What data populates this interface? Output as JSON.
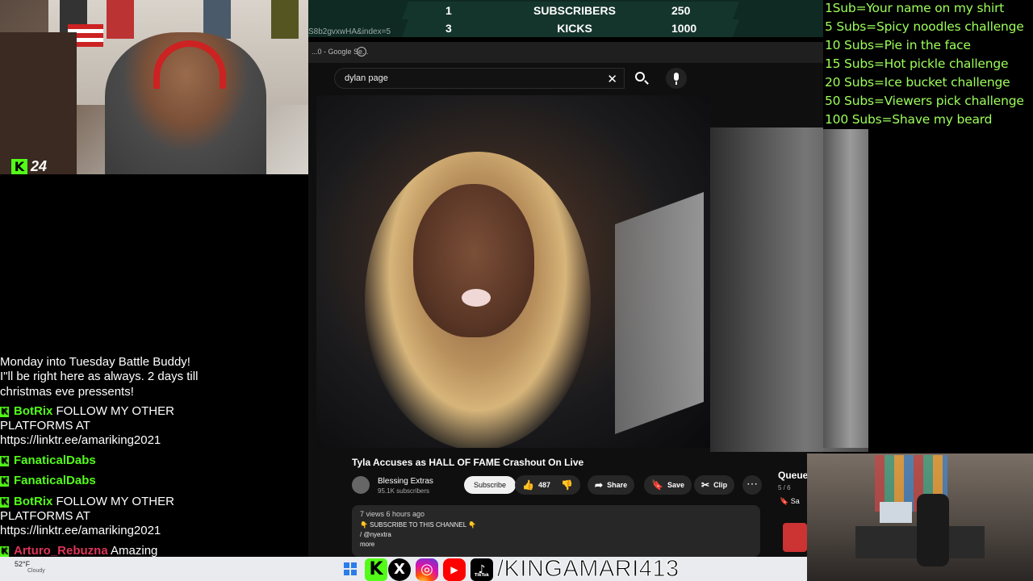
{
  "webcam": {
    "kick_count": "24"
  },
  "counters": {
    "rows": [
      {
        "current": "1",
        "label": "SUBSCRIBERS",
        "goal": "250"
      },
      {
        "current": "3",
        "label": "KICKS",
        "goal": "1000"
      }
    ],
    "url_fragment": "S8b2gvxwHA&index=5"
  },
  "browser": {
    "tab_text": "...0 - Google Se..."
  },
  "youtube": {
    "search_query": "dylan page",
    "video_title": "Tyla Accuses as HALL OF FAME Crashout On Live",
    "channel_name": "Blessing Extras",
    "channel_subs": "95.1K subscribers",
    "subscribe_label": "Subscribe",
    "likes": "487",
    "share_label": "Share",
    "save_label": "Save",
    "clip_label": "Clip",
    "more_label": "⋯",
    "desc_stats": "7 views  6 hours ago",
    "desc_line1": "👇 SUBSCRIBE TO THIS CHANNEL 👇",
    "desc_line2": "/ @nyextra",
    "desc_line3": "more",
    "queue_title": "Queue",
    "queue_count": "5 / 6",
    "queue_save": "Sa"
  },
  "goals": [
    "1Sub=Your name on my shirt",
    "5 Subs=Spicy noodles challenge",
    "10 Subs=Pie in the face",
    "15 Subs=Hot pickle challenge",
    "20 Subs=Ice bucket challenge",
    "50 Subs=Viewers pick challenge",
    "100 Subs=Shave my beard"
  ],
  "chat": [
    {
      "text": "Monday into Tuesday Battle Buddy!"
    },
    {
      "text": "I\"ll be right here as always. 2 days till"
    },
    {
      "text": "christmas eve pressents!"
    },
    {
      "user": "BotRix",
      "color": "#53fc18",
      "text": "FOLLOW MY OTHER"
    },
    {
      "text": "PLATFORMS AT"
    },
    {
      "text": "https://linktr.ee/amariking2021"
    },
    {
      "user": "FanaticalDabs",
      "color": "#53fc18",
      "text": ""
    },
    {
      "user": "FanaticalDabs",
      "color": "#53fc18",
      "text": ""
    },
    {
      "user": "BotRix",
      "color": "#53fc18",
      "text": "FOLLOW MY OTHER"
    },
    {
      "text": "PLATFORMS AT"
    },
    {
      "text": "https://linktr.ee/amariking2021"
    },
    {
      "user": "Arturo_Rebuzna",
      "color": "#e0335a",
      "text": "Amazing"
    }
  ],
  "taskbar": {
    "weather_temp": "52°F",
    "weather_desc": "Cloudy"
  },
  "social": {
    "kick": "K",
    "x": "X",
    "instagram": "◎",
    "youtube": "▶",
    "tiktok": "♪",
    "tiktok_label": "TikTok",
    "handle": "/KINGAMARI413"
  },
  "colors": {
    "kick_green": "#53fc18",
    "goal_green": "#9dff5a",
    "counter_bg": "#0f2a22",
    "yt_bg": "#0f0f0f"
  }
}
